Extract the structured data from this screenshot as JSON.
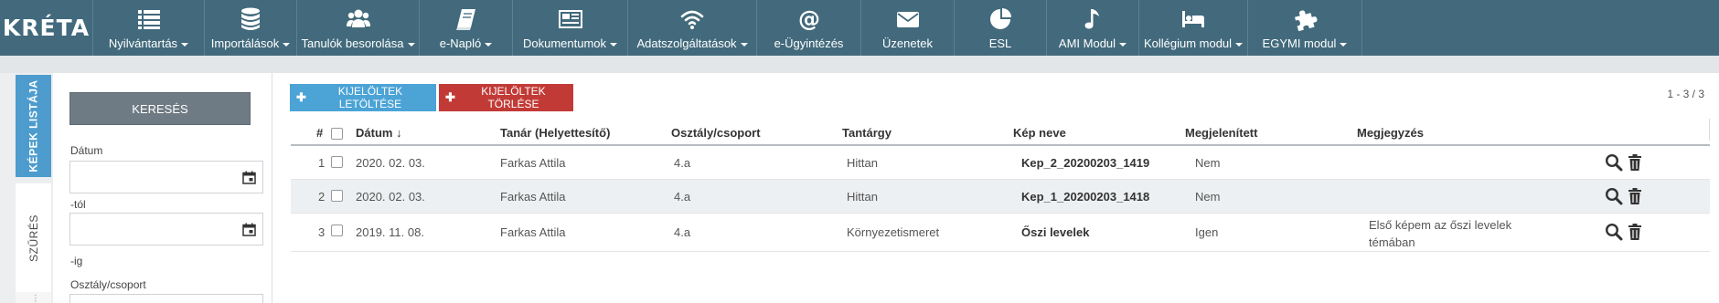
{
  "app": {
    "logo": "KRÉTA"
  },
  "nav": [
    {
      "label": "Nyilvántartás",
      "icon": "list-icon",
      "caret": true
    },
    {
      "label": "Importálások",
      "icon": "database-icon",
      "caret": true
    },
    {
      "label": "Tanulók besorolása",
      "icon": "users-icon",
      "caret": true
    },
    {
      "label": "e-Napló",
      "icon": "book-icon",
      "caret": true
    },
    {
      "label": "Dokumentumok",
      "icon": "newspaper-icon",
      "caret": true
    },
    {
      "label": "Adatszolgáltatások",
      "icon": "wifi-icon",
      "caret": true
    },
    {
      "label": "e-Ügyintézés",
      "icon": "at-icon",
      "caret": false
    },
    {
      "label": "Üzenetek",
      "icon": "envelope-icon",
      "caret": false
    },
    {
      "label": "ESL",
      "icon": "pie-chart-icon",
      "caret": false
    },
    {
      "label": "AMI Modul",
      "icon": "music-icon",
      "caret": true
    },
    {
      "label": "Kollégium modul",
      "icon": "bed-icon",
      "caret": true
    },
    {
      "label": "EGYMI modul",
      "icon": "puzzle-icon",
      "caret": true
    }
  ],
  "side_tabs": {
    "list": "KÉPEK LISTÁJA",
    "filter": "SZŰRÉS",
    "third": "..."
  },
  "filter": {
    "search_button": "KERESÉS",
    "date_label": "Dátum",
    "from_suffix": "-tól",
    "to_suffix": "-ig",
    "class_label": "Osztály/csoport",
    "date_from_value": "",
    "date_to_value": ""
  },
  "toolbar": {
    "download_label": "KIJELÖLTEK LETÖLTÉSE",
    "delete_label": "KIJELÖLTEK TÖRLÉSE",
    "pager": "1 - 3 / 3"
  },
  "table": {
    "headers": {
      "num": "#",
      "date": "Dátum",
      "teacher": "Tanár (Helyettesítő)",
      "class": "Osztály/csoport",
      "subject": "Tantárgy",
      "image_name": "Kép neve",
      "displayed": "Megjelenített",
      "note": "Megjegyzés"
    },
    "rows": [
      {
        "num": "1",
        "date": "2020. 02. 03.",
        "teacher": "Farkas Attila",
        "class": "4.a",
        "subject": "Hittan",
        "image_name": "Kep_2_20200203_1419",
        "displayed": "Nem",
        "note_line1": "",
        "note_line2": ""
      },
      {
        "num": "2",
        "date": "2020. 02. 03.",
        "teacher": "Farkas Attila",
        "class": "4.a",
        "subject": "Hittan",
        "image_name": "Kep_1_20200203_1418",
        "displayed": "Nem",
        "note_line1": "",
        "note_line2": ""
      },
      {
        "num": "3",
        "date": "2019. 11. 08.",
        "teacher": "Farkas Attila",
        "class": "4.a",
        "subject": "Környezetismeret",
        "image_name": "Őszi levelek",
        "displayed": "Igen",
        "note_line1": "Első képem az őszi levelek",
        "note_line2": "témában"
      }
    ]
  },
  "colors": {
    "topbar": "#426a7c",
    "accent_blue": "#4ba3d6",
    "danger_red": "#c23a36",
    "search_button": "#6f7b84"
  }
}
